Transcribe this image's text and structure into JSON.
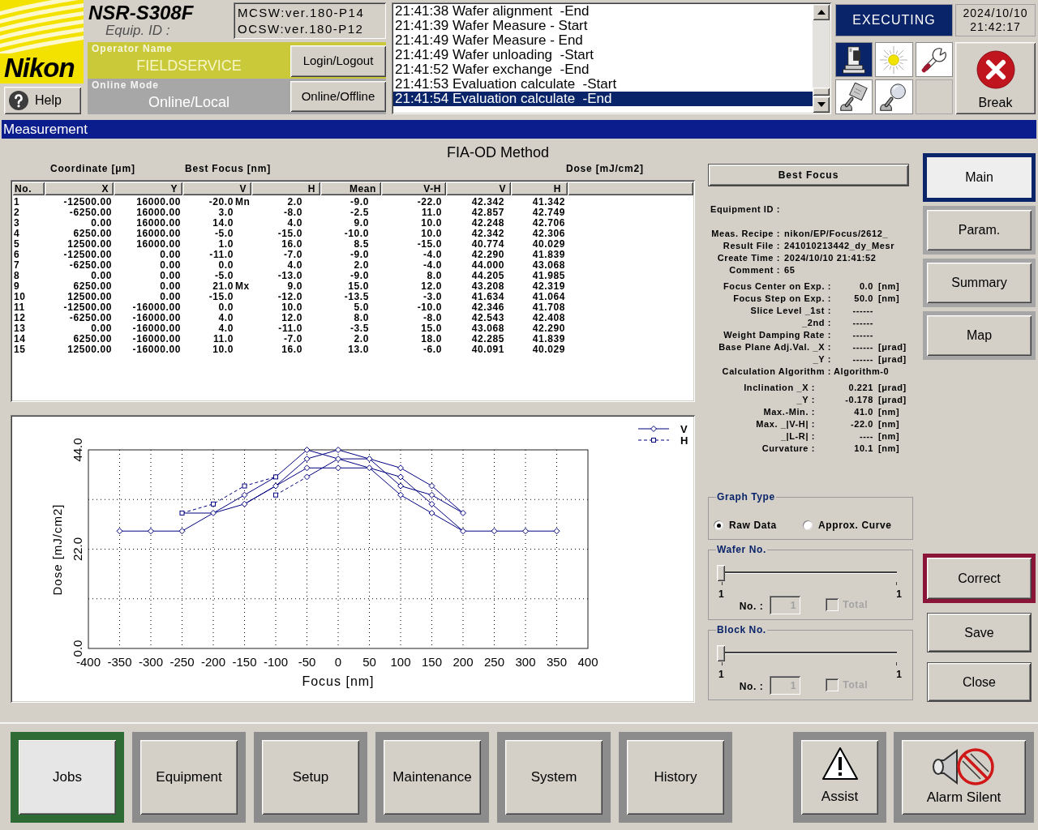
{
  "header": {
    "logo": "Nikon",
    "help": "Help",
    "model": "NSR-S308F",
    "equip_id_label": "Equip. ID :",
    "versions": [
      "MCSW:ver.180-P14",
      "OCSW:ver.180-P12"
    ],
    "operator": {
      "label": "Operator Name",
      "value": "FIELDSERVICE",
      "button": "Login/Logout"
    },
    "online": {
      "label": "Online Mode",
      "value": "Online/Local",
      "button": "Online/Offline"
    },
    "log": [
      {
        "text": "21:41:38 Wafer alignment  -End",
        "selected": false
      },
      {
        "text": "21:41:39 Wafer Measure - Start",
        "selected": false
      },
      {
        "text": "21:41:49 Wafer Measure - End",
        "selected": false
      },
      {
        "text": "21:41:49 Wafer unloading  -Start",
        "selected": false
      },
      {
        "text": "21:41:52 Wafer exchange  -End",
        "selected": false
      },
      {
        "text": "21:41:53 Evaluation calculate  -Start",
        "selected": false
      },
      {
        "text": "21:41:54 Evaluation calculate  -End",
        "selected": true
      }
    ],
    "status": "EXECUTING",
    "date": "2024/10/10",
    "time": "21:42:17",
    "tool_icons": [
      {
        "selected": true
      },
      {
        "selected": false
      },
      {
        "selected": false
      },
      {
        "selected": false
      },
      {
        "selected": false
      }
    ],
    "break_button": "Break"
  },
  "window_title": "Measurement",
  "method_title": "FIA-OD Method",
  "table": {
    "column_groups": [
      {
        "label": "Coordinate [μm]"
      },
      {
        "label": "Best Focus [nm]"
      },
      {
        "label": "Dose [mJ/cm2]"
      }
    ],
    "columns": [
      {
        "label": "No."
      },
      {
        "label": "X"
      },
      {
        "label": "Y"
      },
      {
        "label": "V"
      },
      {
        "label": "H"
      },
      {
        "label": "Mean"
      },
      {
        "label": "V-H"
      },
      {
        "label": "V"
      },
      {
        "label": "H"
      }
    ],
    "rows": [
      {
        "cells": [
          "1",
          "-12500.00",
          "16000.00",
          "-20.0",
          "2.0",
          "-9.0",
          "-22.0",
          "42.342",
          "41.342"
        ],
        "flag": "Mn"
      },
      {
        "cells": [
          "2",
          "-6250.00",
          "16000.00",
          "3.0",
          "-8.0",
          "-2.5",
          "11.0",
          "42.857",
          "42.749"
        ]
      },
      {
        "cells": [
          "3",
          "0.00",
          "16000.00",
          "14.0",
          "4.0",
          "9.0",
          "10.0",
          "42.248",
          "42.706"
        ]
      },
      {
        "cells": [
          "4",
          "6250.00",
          "16000.00",
          "-5.0",
          "-15.0",
          "-10.0",
          "10.0",
          "42.342",
          "42.306"
        ]
      },
      {
        "cells": [
          "5",
          "12500.00",
          "16000.00",
          "1.0",
          "16.0",
          "8.5",
          "-15.0",
          "40.774",
          "40.029"
        ]
      },
      {
        "cells": [
          "6",
          "-12500.00",
          "0.00",
          "-11.0",
          "-7.0",
          "-9.0",
          "-4.0",
          "42.290",
          "41.839"
        ]
      },
      {
        "cells": [
          "7",
          "-6250.00",
          "0.00",
          "0.0",
          "4.0",
          "2.0",
          "-4.0",
          "44.000",
          "43.068"
        ]
      },
      {
        "cells": [
          "8",
          "0.00",
          "0.00",
          "-5.0",
          "-13.0",
          "-9.0",
          "8.0",
          "44.205",
          "41.985"
        ]
      },
      {
        "cells": [
          "9",
          "6250.00",
          "0.00",
          "21.0",
          "9.0",
          "15.0",
          "12.0",
          "43.208",
          "42.319"
        ],
        "flag": "Mx"
      },
      {
        "cells": [
          "10",
          "12500.00",
          "0.00",
          "-15.0",
          "-12.0",
          "-13.5",
          "-3.0",
          "41.634",
          "41.064"
        ]
      },
      {
        "cells": [
          "11",
          "-12500.00",
          "-16000.00",
          "0.0",
          "10.0",
          "5.0",
          "-10.0",
          "42.346",
          "41.708"
        ]
      },
      {
        "cells": [
          "12",
          "-6250.00",
          "-16000.00",
          "4.0",
          "12.0",
          "8.0",
          "-8.0",
          "42.543",
          "42.408"
        ]
      },
      {
        "cells": [
          "13",
          "0.00",
          "-16000.00",
          "4.0",
          "-11.0",
          "-3.5",
          "15.0",
          "43.068",
          "42.290"
        ]
      },
      {
        "cells": [
          "14",
          "6250.00",
          "-16000.00",
          "11.0",
          "-7.0",
          "2.0",
          "18.0",
          "42.285",
          "41.839"
        ]
      },
      {
        "cells": [
          "15",
          "12500.00",
          "-16000.00",
          "10.0",
          "16.0",
          "13.0",
          "-6.0",
          "40.091",
          "40.029"
        ]
      }
    ]
  },
  "chart": {
    "chart_data": {
      "type": "line",
      "xlabel": "Focus [nm]",
      "ylabel": "Dose [mJ/cm2]",
      "x": [
        -350,
        -300,
        -250,
        -200,
        -150,
        -100,
        -50,
        0,
        50,
        100,
        150,
        200,
        250,
        300,
        350
      ],
      "series": [
        {
          "name": "V",
          "line_style": "solid",
          "marker": "diamond",
          "color": "#000080",
          "values": [
            26,
            26,
            26,
            30,
            32,
            36,
            40,
            40,
            40,
            38,
            32,
            26,
            26,
            26,
            26
          ]
        },
        {
          "name": "H",
          "line_style": "dashed",
          "marker": "square",
          "color": "#000080",
          "values": [
            null,
            null,
            30,
            32,
            36,
            38,
            null,
            null,
            null,
            null,
            null,
            null,
            null,
            null,
            null
          ]
        },
        {
          "line_style": "solid",
          "marker": "diamond",
          "color": "#000080",
          "values": [
            null,
            null,
            30,
            30,
            34,
            38,
            44,
            42,
            42,
            36,
            34,
            30,
            null,
            null,
            null
          ]
        },
        {
          "line_style": "solid",
          "marker": "diamond",
          "color": "#000080",
          "values": [
            null,
            null,
            null,
            null,
            32,
            36,
            42,
            44,
            42,
            40,
            36,
            30,
            null,
            null,
            null
          ]
        },
        {
          "line_style": "solid",
          "marker": "diamond",
          "color": "#000080",
          "values": [
            null,
            null,
            null,
            null,
            null,
            null,
            38,
            42,
            40,
            34,
            30,
            26,
            null,
            null,
            null
          ]
        },
        {
          "line_style": "dashed",
          "marker": "square",
          "color": "#000080",
          "values": [
            null,
            null,
            null,
            null,
            null,
            34,
            38,
            null,
            null,
            null,
            null,
            null,
            null,
            null,
            null
          ]
        }
      ],
      "xlim": [
        -400,
        400
      ],
      "ylim": [
        0,
        44
      ],
      "xticks": [
        -400,
        -350,
        -300,
        -250,
        -200,
        -150,
        -100,
        -50,
        0,
        50,
        100,
        150,
        200,
        250,
        300,
        350,
        400
      ],
      "yticks": [
        {
          "value": 0,
          "label": "0.0"
        },
        {
          "value": 22,
          "label": "22.0"
        },
        {
          "value": 44,
          "label": "44.0"
        }
      ],
      "grid": true,
      "legend": true
    }
  },
  "best_focus_button": "Best Focus",
  "info_groups": [
    {
      "kind": "header",
      "rows": [
        {
          "label": "Equipment ID :"
        },
        {
          "label": "Meas. Recipe :",
          "value": "nikon/EP/Focus/2612_"
        },
        {
          "label": "Result File :",
          "value": "241010213442_dy_Mesr"
        },
        {
          "label": "Create Time :",
          "value": "2024/10/10 21:41:52"
        },
        {
          "label": "Comment :",
          "value": "65"
        }
      ]
    },
    {
      "kind": "params",
      "rows": [
        {
          "kind": "number",
          "label": "Focus Center on Exp. :",
          "value": "0.0",
          "unit": "[nm]"
        },
        {
          "kind": "number",
          "label": "Focus Step on Exp. :",
          "value": "50.0",
          "unit": "[nm]"
        },
        {
          "kind": "number",
          "label": "Slice Level _1st :",
          "value": "------"
        },
        {
          "kind": "number",
          "label": "_2nd :",
          "value": "------"
        },
        {
          "kind": "number",
          "label": "Weight Damping Rate :",
          "value": "------"
        },
        {
          "kind": "number",
          "label": "Base Plane Adj.Val. _X :",
          "value": "------",
          "unit": "[μrad]"
        },
        {
          "kind": "number",
          "label": "_Y :",
          "value": "------",
          "unit": "[μrad]"
        },
        {
          "kind": "text",
          "label": "Calculation Algorithm :",
          "value": "Algorithm-0"
        }
      ]
    },
    {
      "kind": "results",
      "rows": [
        {
          "kind": "number",
          "label": "Inclination _X :",
          "value": "0.221",
          "unit": "[μrad]"
        },
        {
          "kind": "number",
          "label": "_Y :",
          "value": "-0.178",
          "unit": "[μrad]"
        },
        {
          "kind": "number",
          "label": "Max.-Min. :",
          "value": "41.0",
          "unit": "[nm]"
        },
        {
          "kind": "number",
          "label": "Max. _|V-H| :",
          "value": "-22.0",
          "unit": "[nm]"
        },
        {
          "kind": "number",
          "label": "_|L-R| :",
          "value": "----",
          "unit": "[nm]"
        },
        {
          "kind": "number",
          "label": "Curvature :",
          "value": "10.1",
          "unit": "[nm]"
        }
      ]
    }
  ],
  "graph_type": {
    "title": "Graph Type",
    "options": [
      {
        "label": "Raw Data",
        "selected": true
      },
      {
        "label": "Approx. Curve",
        "selected": false
      }
    ]
  },
  "sliders": [
    {
      "title": "Wafer No.",
      "level": 0,
      "min": "1",
      "max": "1",
      "no_label": "No. :",
      "no_value": "1",
      "total_label": "Total",
      "total_checked": false,
      "disabled": true
    },
    {
      "title": "Block No.",
      "level": 0,
      "min": "1",
      "max": "1",
      "no_label": "No. :",
      "no_value": "1",
      "total_label": "Total",
      "total_checked": false,
      "disabled": true
    }
  ],
  "side_tabs": [
    {
      "label": "Main",
      "selected": true
    },
    {
      "label": "Param.",
      "selected": false
    },
    {
      "label": "Summary",
      "selected": false
    },
    {
      "label": "Map",
      "selected": false
    }
  ],
  "actions": [
    {
      "label": "Correct",
      "emphasized": true
    },
    {
      "label": "Save",
      "emphasized": false
    },
    {
      "label": "Close",
      "emphasized": false
    }
  ],
  "nav": [
    {
      "label": "Jobs",
      "selected": true
    },
    {
      "label": "Equipment",
      "selected": false
    },
    {
      "label": "Setup",
      "selected": false
    },
    {
      "label": "Maintenance",
      "selected": false
    },
    {
      "label": "System",
      "selected": false
    },
    {
      "label": "History",
      "selected": false
    }
  ],
  "system_buttons": [
    {
      "label": "Assist"
    },
    {
      "label": "Alarm Silent"
    }
  ]
}
